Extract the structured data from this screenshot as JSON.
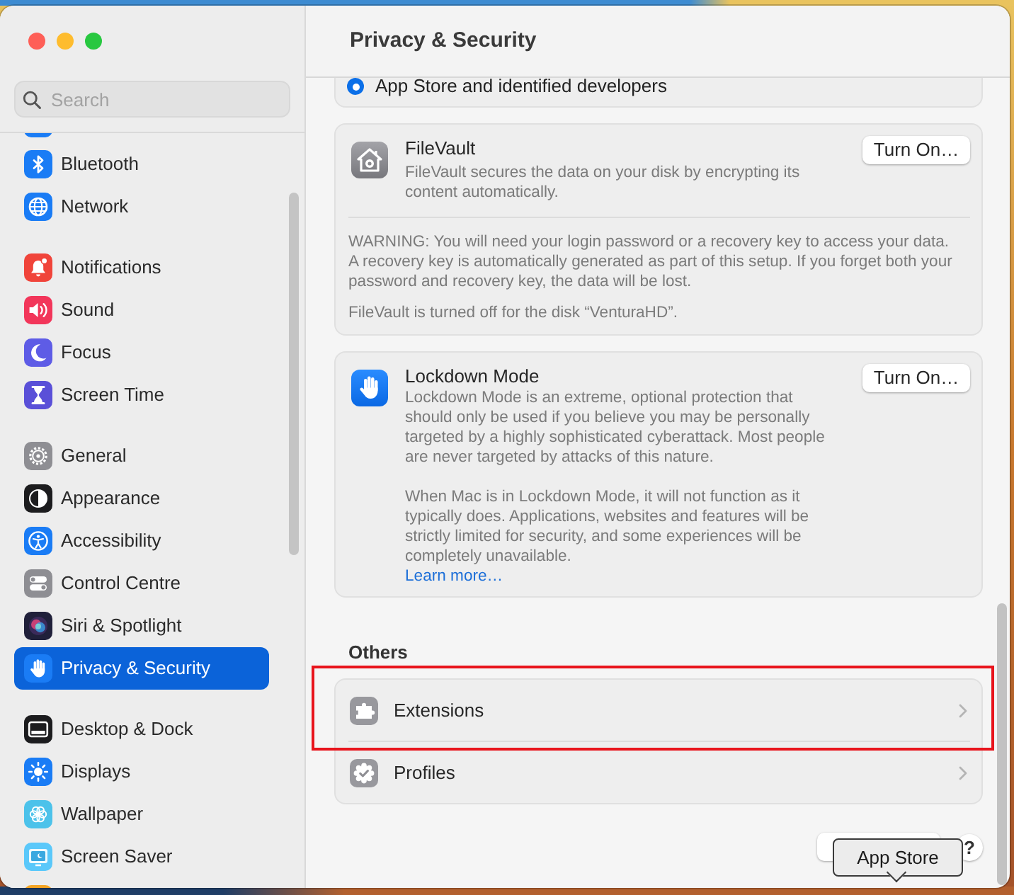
{
  "window": {
    "title": "Privacy & Security"
  },
  "sidebar": {
    "search": {
      "placeholder": "Search"
    },
    "groups": [
      {
        "items": [
          {
            "label": "Bluetooth",
            "selected": false
          },
          {
            "label": "Network",
            "selected": false
          }
        ]
      },
      {
        "items": [
          {
            "label": "Notifications",
            "selected": false
          },
          {
            "label": "Sound",
            "selected": false
          },
          {
            "label": "Focus",
            "selected": false
          },
          {
            "label": "Screen Time",
            "selected": false
          }
        ]
      },
      {
        "items": [
          {
            "label": "General",
            "selected": false
          },
          {
            "label": "Appearance",
            "selected": false
          },
          {
            "label": "Accessibility",
            "selected": false
          },
          {
            "label": "Control Centre",
            "selected": false
          },
          {
            "label": "Siri & Spotlight",
            "selected": false
          },
          {
            "label": "Privacy & Security",
            "selected": true
          }
        ]
      },
      {
        "items": [
          {
            "label": "Desktop & Dock",
            "selected": false
          },
          {
            "label": "Displays",
            "selected": false
          },
          {
            "label": "Wallpaper",
            "selected": false
          },
          {
            "label": "Screen Saver",
            "selected": false
          }
        ]
      }
    ]
  },
  "app_sources": {
    "option": {
      "label": "App Store and identified developers",
      "selected": true
    }
  },
  "filevault": {
    "title": "FileVault",
    "description": "FileVault secures the data on your disk by encrypting its content automatically.",
    "button": "Turn On…",
    "warning": "WARNING: You will need your login password or a recovery key to access your data. A recovery key is automatically generated as part of this setup. If you forget both your password and recovery key, the data will be lost.",
    "status": "FileVault is turned off for the disk “VenturaHD”."
  },
  "lockdown_mode": {
    "title": "Lockdown Mode",
    "description": [
      "Lockdown Mode is an extreme, optional protection that should only be used if you believe you may be personally targeted by a highly sophisticated cyberattack. Most people are never targeted by attacks of this nature.",
      "When Mac is in Lockdown Mode, it will not function as it typically does. Applications, websites and features will be strictly limited for security, and some experiences will be completely unavailable."
    ],
    "link": "Learn more…",
    "button": "Turn On…"
  },
  "others": {
    "heading": "Others",
    "items": [
      {
        "label": "Extensions",
        "highlighted": true
      },
      {
        "label": "Profiles",
        "highlighted": false
      }
    ]
  },
  "footer": {
    "help_button": "?"
  },
  "tooltip": "App Store"
}
